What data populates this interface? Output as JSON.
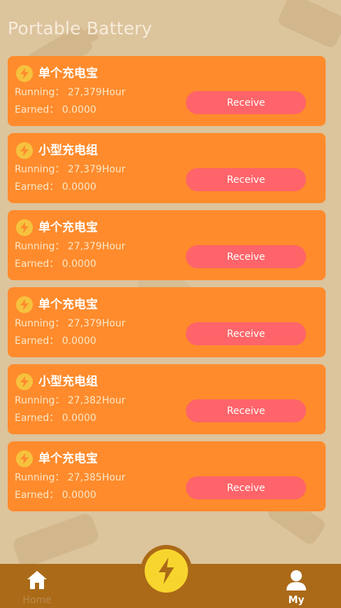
{
  "page": {
    "title": "Portable Battery"
  },
  "cards": [
    {
      "name": "单个充电宝",
      "running_label": "Running：",
      "running_value": "27,379Hour",
      "earned_label": "Earned：",
      "earned_value": "0.0000",
      "button": "Receive"
    },
    {
      "name": "小型充电组",
      "running_label": "Running：",
      "running_value": "27,379Hour",
      "earned_label": "Earned：",
      "earned_value": "0.0000",
      "button": "Receive"
    },
    {
      "name": "单个充电宝",
      "running_label": "Running：",
      "running_value": "27,379Hour",
      "earned_label": "Earned：",
      "earned_value": "0.0000",
      "button": "Receive"
    },
    {
      "name": "单个充电宝",
      "running_label": "Running：",
      "running_value": "27,379Hour",
      "earned_label": "Earned：",
      "earned_value": "0.0000",
      "button": "Receive"
    },
    {
      "name": "小型充电组",
      "running_label": "Running：",
      "running_value": "27,382Hour",
      "earned_label": "Earned：",
      "earned_value": "0.0000",
      "button": "Receive"
    },
    {
      "name": "单个充电宝",
      "running_label": "Running：",
      "running_value": "27,385Hour",
      "earned_label": "Earned：",
      "earned_value": "0.0000",
      "button": "Receive"
    }
  ],
  "tabbar": {
    "home_label": "Home",
    "home_icon": "home-icon",
    "center_icon": "lightning-bolt-icon",
    "my_label": "My",
    "my_icon": "user-icon"
  },
  "colors": {
    "background": "#dcc49d",
    "card": "#ff8b2c",
    "button": "#fe6469",
    "tabbar": "#ab6a17",
    "center_button": "#f8d52e"
  }
}
